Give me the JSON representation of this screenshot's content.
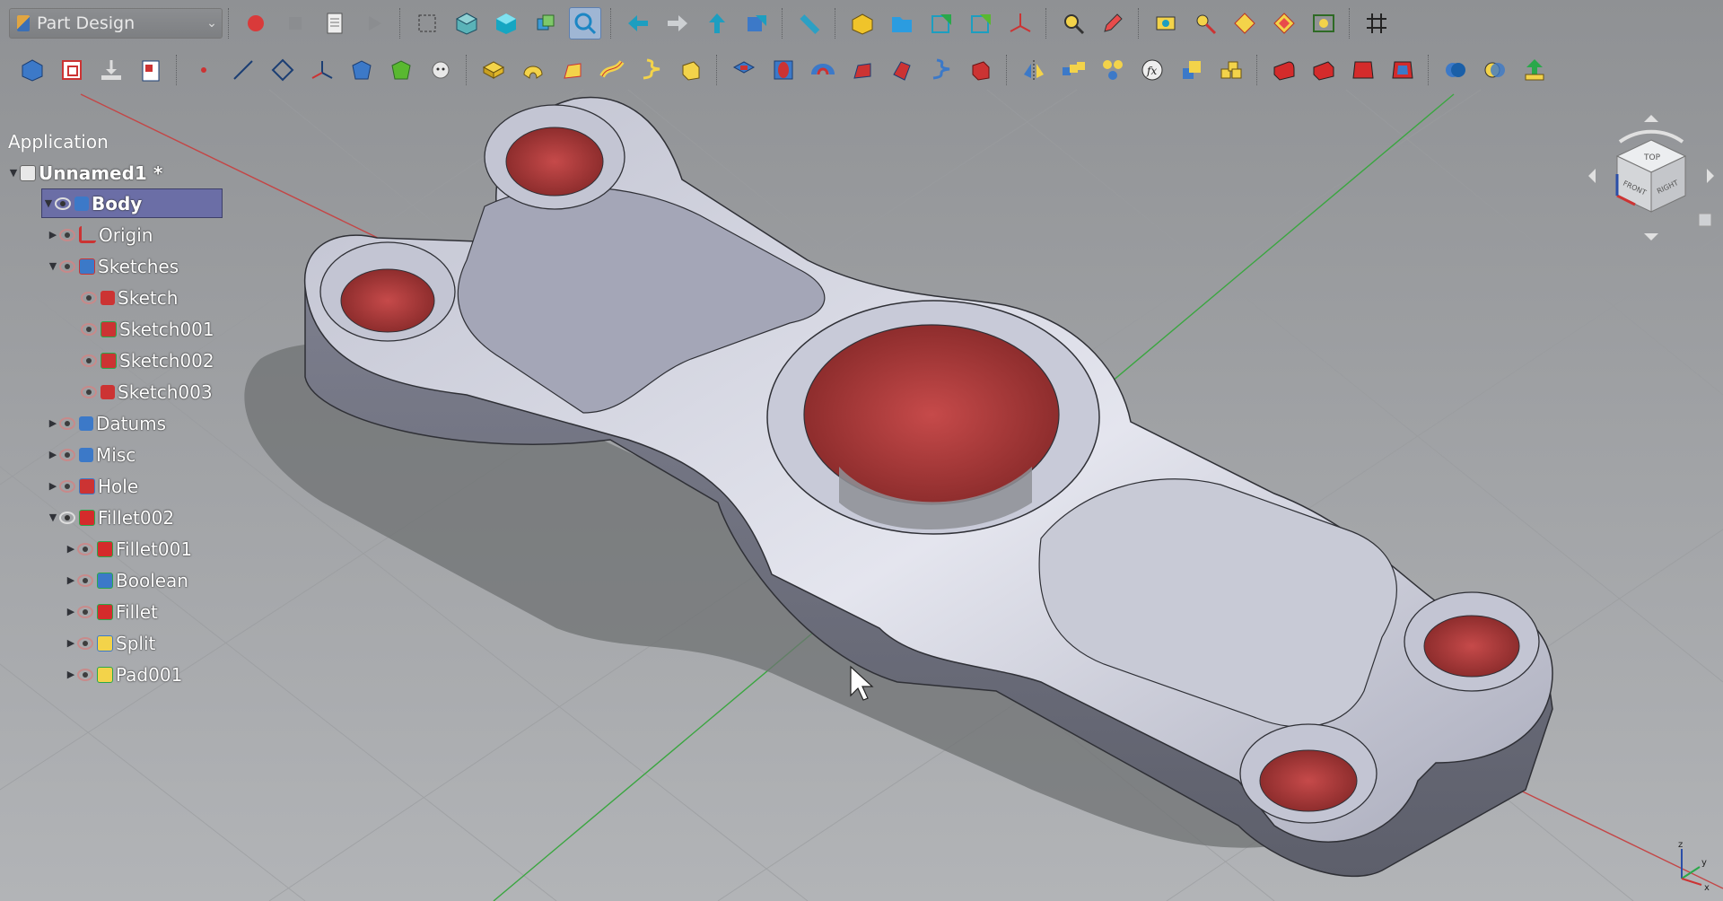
{
  "toolbar": {
    "workbench": "Part Design"
  },
  "tree": {
    "header": "Application",
    "document": "Unnamed1 *",
    "items": [
      {
        "label": "Body"
      },
      {
        "label": "Origin"
      },
      {
        "label": "Sketches"
      },
      {
        "label": "Sketch"
      },
      {
        "label": "Sketch001"
      },
      {
        "label": "Sketch002"
      },
      {
        "label": "Sketch003"
      },
      {
        "label": "Datums"
      },
      {
        "label": "Misc"
      },
      {
        "label": "Hole"
      },
      {
        "label": "Fillet002"
      },
      {
        "label": "Fillet001"
      },
      {
        "label": "Boolean"
      },
      {
        "label": "Fillet"
      },
      {
        "label": "Split"
      },
      {
        "label": "Pad001"
      }
    ]
  },
  "navcube": {
    "top": "TOP",
    "front": "FRONT",
    "right": "RIGHT"
  },
  "axis": {
    "z": "z",
    "y": "y",
    "x": "x"
  },
  "colors": {
    "part_body": "#b8bac9",
    "part_side": "#7f8190",
    "hole_red": "#b23b3b",
    "selection": "#6b6ea6",
    "background": "#a6a8ab"
  }
}
